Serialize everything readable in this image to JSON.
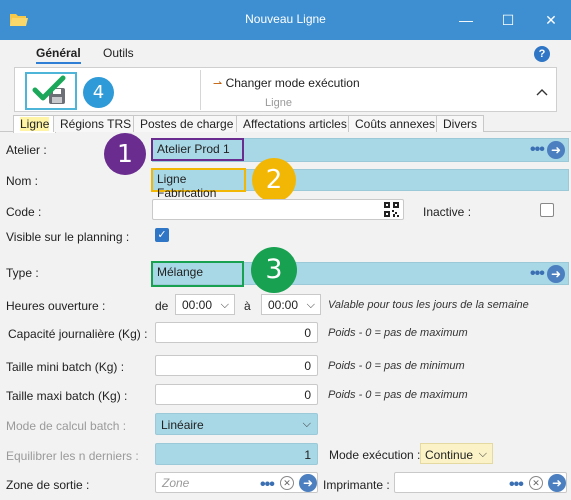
{
  "window": {
    "title": "Nouveau Ligne",
    "icon": "folder-icon",
    "controls": [
      "—",
      "☐",
      "✕"
    ]
  },
  "ribbon": {
    "tabs": [
      "Général",
      "Outils"
    ],
    "active_tab": "Général",
    "help_label": "?",
    "change_mode_label": "Changer mode exécution",
    "group_label": "Ligne",
    "collapse_label": "^"
  },
  "callouts": {
    "one": "1",
    "two": "2",
    "three": "3",
    "four": "4",
    "colors": {
      "one": "#6a2c8e",
      "two": "#f2b705",
      "three": "#17a150",
      "four": "#2e9ad7"
    }
  },
  "tabs": [
    "Ligne",
    "Régions TRS",
    "Postes de charge",
    "Affectations articles",
    "Coûts annexes",
    "Divers"
  ],
  "form": {
    "atelier": {
      "label": "Atelier :",
      "value": "Atelier Prod 1"
    },
    "nom": {
      "label": "Nom :",
      "value": "Ligne Fabrication"
    },
    "code": {
      "label": "Code :",
      "value": ""
    },
    "inactive": {
      "label": "Inactive :",
      "checked": false
    },
    "visible": {
      "label": "Visible sur le planning :",
      "checked": true
    },
    "type": {
      "label": "Type :",
      "value": "Mélange"
    },
    "heures": {
      "label": "Heures ouverture :",
      "de": "de",
      "a": "à",
      "start": "00:00",
      "end": "00:00",
      "note": "Valable pour tous les jours de la semaine"
    },
    "capacite": {
      "label": "Capacité journalière (Kg) :",
      "value": "0",
      "note": "Poids - 0 = pas de maximum"
    },
    "mini": {
      "label": "Taille mini batch (Kg) :",
      "value": "0",
      "note": "Poids - 0 = pas de minimum"
    },
    "maxi": {
      "label": "Taille maxi batch (Kg) :",
      "value": "0",
      "note": "Poids - 0 = pas de maximum"
    },
    "mode_calcul": {
      "label": "Mode de calcul batch :",
      "value": "Linéaire"
    },
    "equilibrer": {
      "label": "Equilibrer les n derniers :",
      "value": "1"
    },
    "mode_exec": {
      "label": "Mode exécution :",
      "value": "Continue"
    },
    "zone": {
      "label": "Zone de sortie :",
      "placeholder": "Zone"
    },
    "imprimante": {
      "label": "Imprimante :",
      "value": ""
    }
  }
}
